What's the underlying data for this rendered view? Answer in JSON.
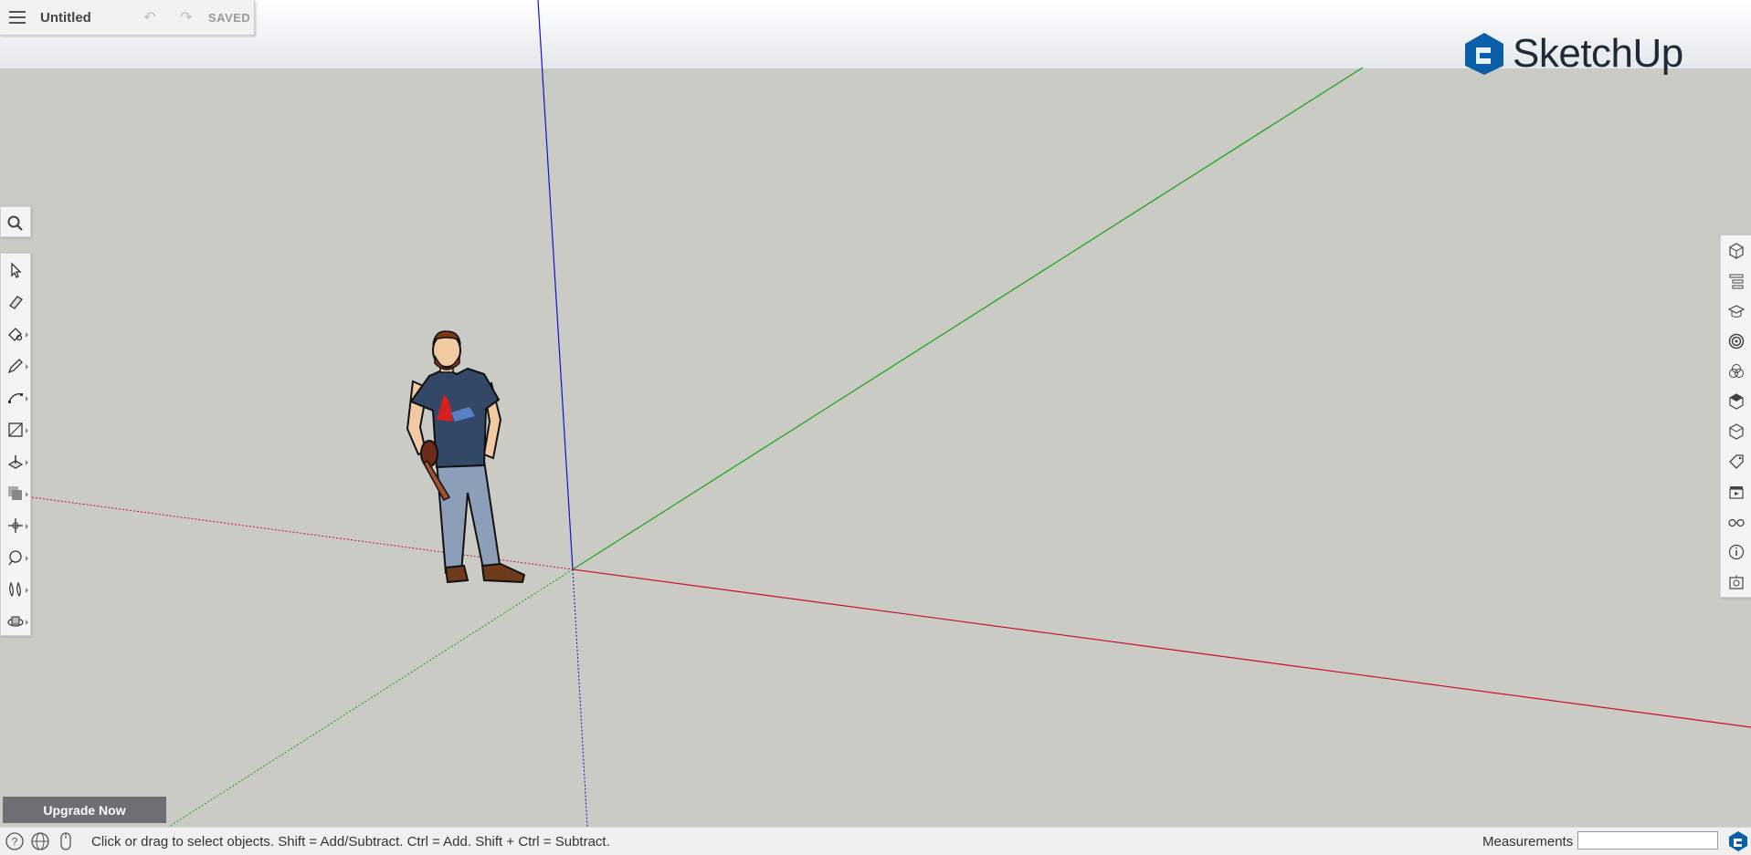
{
  "document": {
    "title": "Untitled",
    "save_status": "SAVED",
    "undo_icon": "undo-icon",
    "redo_icon": "redo-icon"
  },
  "brand": {
    "name": "SketchUp",
    "color": "#0b5ea8"
  },
  "axes_colors": {
    "red": "#c8102e",
    "green": "#12a312",
    "blue": "#1212c8"
  },
  "left_toolbar": {
    "search": "search-icon",
    "tools": [
      {
        "name": "select-tool-icon"
      },
      {
        "name": "eraser-tool-icon"
      },
      {
        "name": "paint-bucket-tool-icon"
      },
      {
        "name": "pencil-tool-icon"
      },
      {
        "name": "arc-tool-icon"
      },
      {
        "name": "rectangle-tool-icon"
      },
      {
        "name": "push-pull-tool-icon"
      },
      {
        "name": "offset-tool-icon"
      },
      {
        "name": "move-tool-icon"
      },
      {
        "name": "tape-measure-tool-icon"
      },
      {
        "name": "walk-tool-icon"
      },
      {
        "name": "orbit-tool-icon"
      }
    ]
  },
  "right_panel": {
    "items": [
      "entity-info-icon",
      "outliner-icon",
      "instructor-icon",
      "components-icon",
      "materials-icon",
      "styles-icon",
      "3d-warehouse-icon",
      "tags-icon",
      "scenes-icon",
      "display-icon",
      "model-info-icon",
      "shadows-icon"
    ]
  },
  "upgrade": {
    "label": "Upgrade Now"
  },
  "status_bar": {
    "message": "Click or drag to select objects. Shift = Add/Subtract. Ctrl = Add. Shift + Ctrl = Subtract.",
    "measurements_label": "Measurements",
    "measurements_value": ""
  }
}
